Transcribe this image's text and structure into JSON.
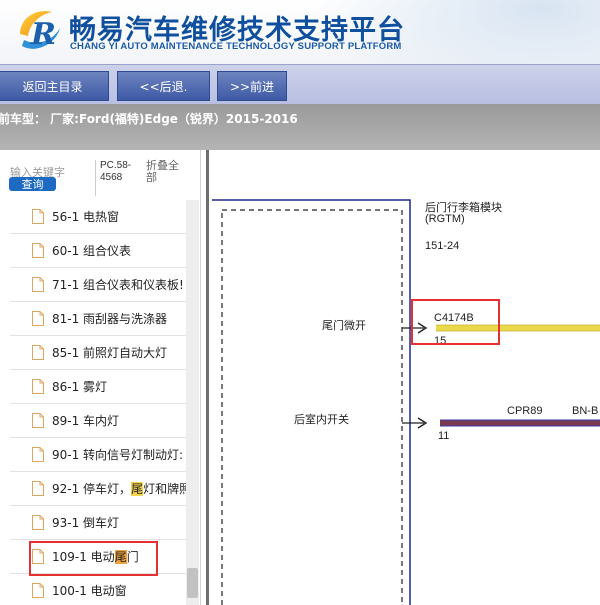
{
  "header": {
    "title_cn": "畅易汽车维修技术支持平台",
    "title_en": "CHANG YI AUTO MAINTENANCE TECHNOLOGY SUPPORT PLATFORM",
    "logo_letter": "R"
  },
  "nav": {
    "back_home": "返回主目录",
    "back": "<<后退.",
    "forward": ">>前进"
  },
  "vehicle": {
    "text": "前车型：  厂家:Ford(福特)Edge（锐界）2015-2016"
  },
  "sidebar": {
    "search_placeholder": "输入关键字",
    "search_button": "查询",
    "pc_label": "PC.58-4568",
    "collapse_all": "折叠全部",
    "items": [
      {
        "label": "56-1 电热窗"
      },
      {
        "label": "60-1 组合仪表"
      },
      {
        "label": "71-1 组合仪表和仪表板!"
      },
      {
        "label": "81-1 雨刮器与洗涤器"
      },
      {
        "label": "85-1 前照灯自动大灯"
      },
      {
        "label": "86-1 雾灯"
      },
      {
        "label": "89-1 车内灯"
      },
      {
        "label": "90-1 转向信号灯制动灯:"
      },
      {
        "label_before": "92-1 停车灯，",
        "label_hl": "尾",
        "label_after": "灯和牌照"
      },
      {
        "label": "93-1 倒车灯"
      },
      {
        "label_before": "109-1 电动",
        "label_hl": "尾",
        "label_after": "门"
      },
      {
        "label": "100-1 电动窗"
      }
    ]
  },
  "diagram": {
    "module_name": "后门行李箱模块",
    "module_code": "(RGTM)",
    "page_ref": "151-24",
    "inputs": [
      {
        "label": "尾门微开",
        "connector": "C4174B",
        "pin": "15",
        "wire_color": "#e8d84a"
      },
      {
        "label": "后室内开关",
        "circuit": "CPR89",
        "wire_colors": "BN-B",
        "pin": "11",
        "wire_color": "#7a3a52"
      }
    ]
  },
  "colors": {
    "brand_blue": "#0f4f9e",
    "nav_button": "#4a64ad",
    "highlight_red": "#e53131",
    "search_highlight": "#f5d44a"
  }
}
